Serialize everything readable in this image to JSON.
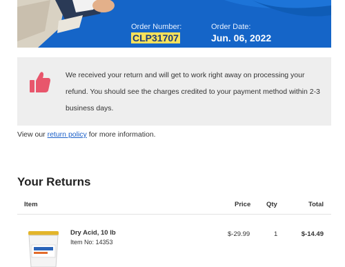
{
  "order": {
    "number_label": "Order Number:",
    "number_value": "CLP31707",
    "date_label": "Order Date:",
    "date_value": "Jun. 06, 2022"
  },
  "notice": {
    "icon": "thumbs-up-icon",
    "text": "We received your return and will get to work right away on processing your refund. You should see the charges credited to your payment method within 2-3 business days."
  },
  "policy": {
    "prefix": "View our ",
    "link_text": "return policy",
    "suffix": " for more information."
  },
  "returns": {
    "title": "Your Returns",
    "columns": {
      "item": "Item",
      "price": "Price",
      "qty": "Qty",
      "total": "Total"
    },
    "items": [
      {
        "name": "Dry Acid, 10 lb",
        "item_no": "Item No: 14353",
        "price": "$-29.99",
        "qty": "1",
        "total": "$-14.49"
      }
    ]
  },
  "colors": {
    "banner": "#1565c8",
    "highlight": "#f7e15a",
    "thumb": "#e8566c",
    "link": "#1a5fc8"
  }
}
